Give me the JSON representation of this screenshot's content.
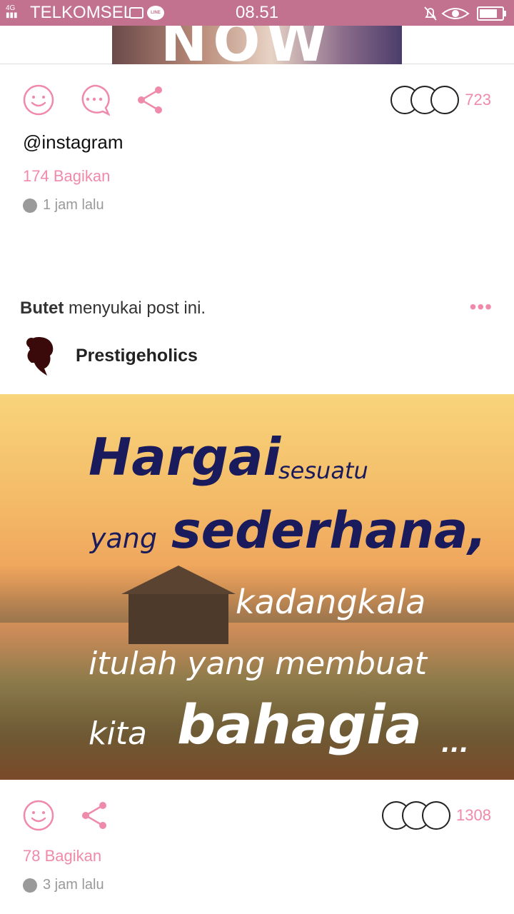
{
  "status_bar": {
    "network": "4G",
    "carrier": "TELKOMSEL",
    "notification_app": "LINE",
    "time": "08.51"
  },
  "top_image": {
    "text": "NOW"
  },
  "post1": {
    "reaction_count": "723",
    "handle": "@instagram",
    "shares": "174 Bagikan",
    "time": "1 jam lalu"
  },
  "post2": {
    "liker": "Butet",
    "liked_text": " menyukai post ini.",
    "more": "•••",
    "author": "Prestigeholics",
    "image_text": {
      "line1_big": "Hargai",
      "line1_small": "sesuatu",
      "line2_small": "yang",
      "line2_big": "sederhana,",
      "line3": "kadangkala",
      "line4": "itulah yang membuat",
      "line5_small": "kita",
      "line5_big": "bahagia",
      "line5_end": "..."
    },
    "reaction_count": "1308",
    "shares": "78 Bagikan",
    "time": "3 jam lalu"
  },
  "colors": {
    "accent": "#f08aaa",
    "status_bar": "#c2718f"
  }
}
